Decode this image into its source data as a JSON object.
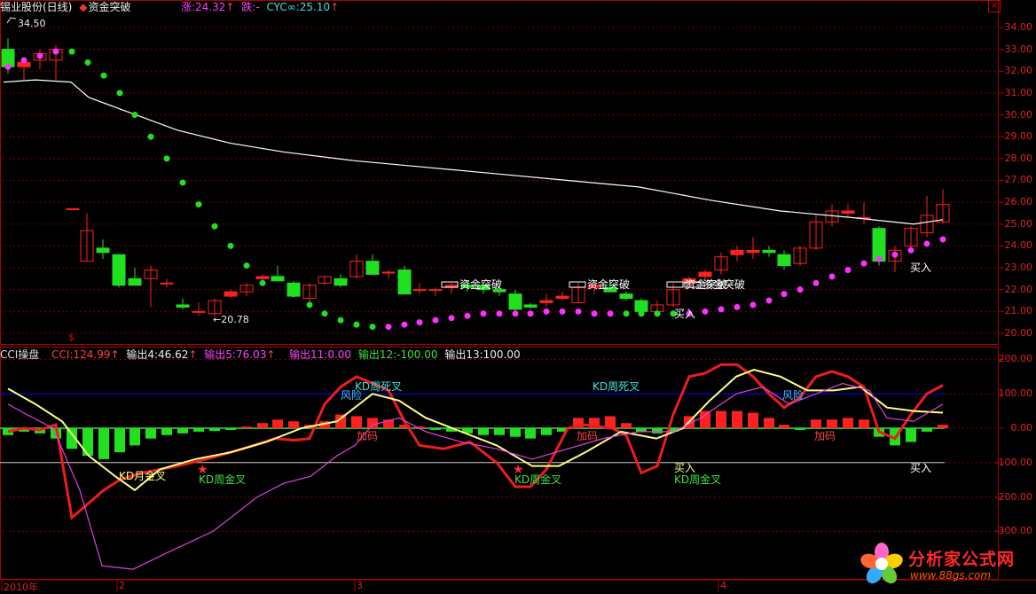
{
  "header": {
    "title": "锡业股份(日线)",
    "indicator": "资金突破",
    "up": "涨:24.32",
    "down": "跌:-",
    "cyc": "CYC∞:25.10"
  },
  "price_panel": {
    "y_ticks": [
      "34.00",
      "33.00",
      "32.00",
      "31.00",
      "30.00",
      "29.00",
      "28.00",
      "27.00",
      "26.00",
      "25.00",
      "24.00",
      "23.00",
      "22.00",
      "21.00",
      "20.00"
    ],
    "high_label": "34.50",
    "low_label": "←20.78",
    "signal_labels": [
      "资金突破",
      "资金突破",
      "资金突破",
      "资金突破"
    ],
    "buy_labels": [
      "买入",
      "买入"
    ]
  },
  "cci_panel": {
    "name": "CCI操盘",
    "cci": "CCI:124.99",
    "out4": "输出4:46.62",
    "out5": "输出5:76.03",
    "out11": "输出11:0.00",
    "out12": "输出12:-100.00",
    "out13": "输出13:100.00",
    "y_ticks": [
      "200.00",
      "100.00",
      "0.00",
      "-100.00",
      "-200.00",
      "-300.00"
    ],
    "annotations": {
      "kd_month_gold": "KD月金叉",
      "kd_week_gold": "KD周金叉",
      "kd_week_dead": "KD周死叉",
      "risk": "风险",
      "add": "加码",
      "buy": "买入"
    }
  },
  "x_axis": {
    "labels": [
      "2010年",
      "2",
      "3",
      "4"
    ]
  },
  "close_icon": "×",
  "dollar_mark": "$",
  "watermark": {
    "title": "分析家公式网",
    "url": "www.88gs.com"
  },
  "colors": {
    "up": "#ff2020",
    "down": "#20e020",
    "ma": "#ffffff",
    "sar_up": "#ff30ff",
    "sar_down": "#20e020",
    "grid": "#7a0000",
    "kd_line": "#0000ff"
  }
}
